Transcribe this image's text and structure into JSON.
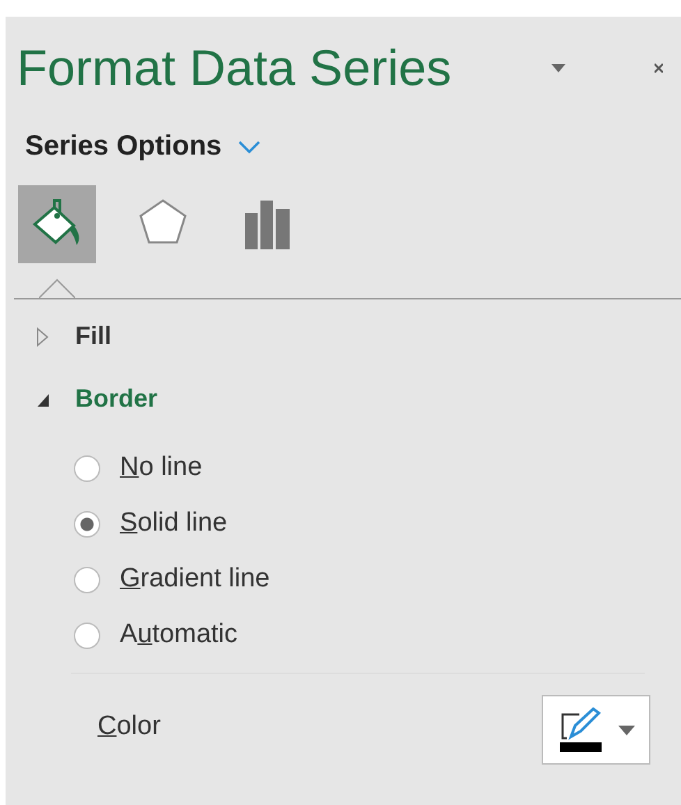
{
  "pane": {
    "title": "Format Data Series",
    "options_label": "Series Options"
  },
  "icon_tabs": [
    {
      "kind": "fill",
      "selected": true
    },
    {
      "kind": "effects",
      "selected": false
    },
    {
      "kind": "series",
      "selected": false
    }
  ],
  "sections": [
    {
      "label": "Fill",
      "expanded": false
    },
    {
      "label": "Border",
      "expanded": true
    }
  ],
  "border_options": [
    {
      "key": "N",
      "after": "o line",
      "selected": false
    },
    {
      "key": "S",
      "after": "olid line",
      "selected": true
    },
    {
      "key": "G",
      "after": "radient line",
      "selected": false
    },
    {
      "before": "A",
      "key": "u",
      "after": "tomatic",
      "selected": false
    }
  ],
  "color_row": {
    "key": "C",
    "after": "olor"
  }
}
